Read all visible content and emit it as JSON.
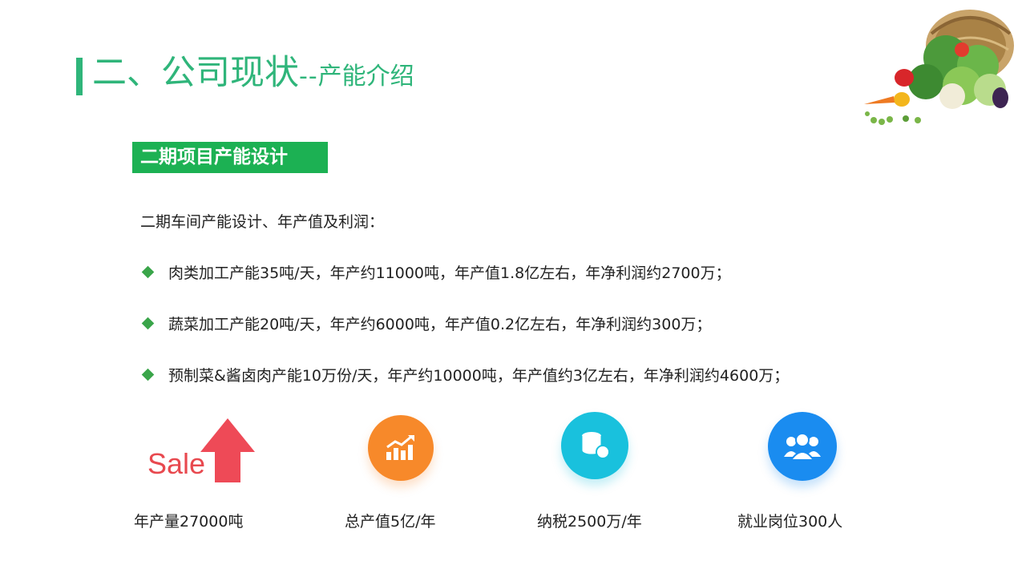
{
  "title": {
    "main": "二、公司现状",
    "dash": "--",
    "sub": "产能介绍"
  },
  "section": {
    "badge": "二期项目产能设计",
    "intro": "二期车间产能设计、年产值及利润："
  },
  "bullets": [
    "肉类加工产能35吨/天，年产约11000吨，年产值1.8亿左右，年净利润约2700万；",
    "蔬菜加工产能20吨/天，年产约6000吨，年产值0.2亿左右，年净利润约300万；",
    "预制菜&酱卤肉产能10万份/天，年产约10000吨，年产值约3亿左右，年净利润约4600万；"
  ],
  "stats": [
    {
      "icon": "sale-up-arrow-icon",
      "label": "年产量27000吨",
      "icon_text": "Sale"
    },
    {
      "icon": "growth-chart-icon",
      "label": "总产值5亿/年"
    },
    {
      "icon": "coin-stack-icon",
      "label": "纳税2500万/年"
    },
    {
      "icon": "people-icon",
      "label": "就业岗位300人"
    }
  ],
  "colors": {
    "title_green": "#2fb57a",
    "badge_green": "#1cb153",
    "bullet_green": "#3aa54a",
    "sale_red": "#e8494f",
    "orange": "#f7892a",
    "cyan": "#19c1dd",
    "blue": "#1a8cf0"
  }
}
